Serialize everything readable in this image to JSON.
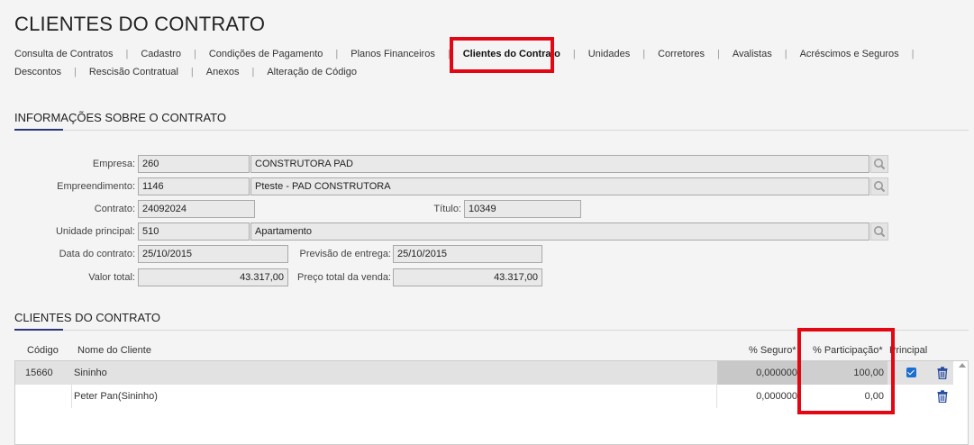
{
  "page_title": "CLIENTES DO CONTRATO",
  "tabs_row1": [
    "Consulta de Contratos",
    "Cadastro",
    "Condições de Pagamento",
    "Planos Financeiros",
    "Clientes do Contrato",
    "Unidades",
    "Corretores",
    "Avalistas",
    "Acréscimos e Seguros"
  ],
  "tabs_row2": [
    "Descontos",
    "Rescisão Contratual",
    "Anexos",
    "Alteração de Código"
  ],
  "active_tab": "Clientes do Contrato",
  "section_info_title": "INFORMAÇÕES SOBRE O CONTRATO",
  "form": {
    "empresa_label": "Empresa:",
    "empresa_code": "260",
    "empresa_name": "CONSTRUTORA PAD",
    "empreendimento_label": "Empreendimento:",
    "empreendimento_code": "1146",
    "empreendimento_name": "Pteste - PAD CONSTRUTORA",
    "contrato_label": "Contrato:",
    "contrato_value": "24092024",
    "titulo_label": "Título:",
    "titulo_value": "10349",
    "unidade_label": "Unidade principal:",
    "unidade_code": "510",
    "unidade_name": "Apartamento",
    "data_contrato_label": "Data do contrato:",
    "data_contrato_value": "25/10/2015",
    "previsao_label": "Previsão de entrega:",
    "previsao_value": "25/10/2015",
    "valor_total_label": "Valor total:",
    "valor_total_value": "43.317,00",
    "preco_total_label": "Preço total da venda:",
    "preco_total_value": "43.317,00"
  },
  "section_clients_title": "CLIENTES DO CONTRATO",
  "grid": {
    "headers": {
      "codigo": "Código",
      "nome": "Nome do Cliente",
      "seguro": "% Seguro*",
      "participacao": "% Participação*",
      "principal": "Principal"
    },
    "rows": [
      {
        "codigo": "15660",
        "nome": "Sininho",
        "seguro": "0,000000",
        "participacao": "100,00",
        "principal": true
      },
      {
        "codigo": "",
        "nome": "Peter Pan(Sininho)",
        "seguro": "0,000000",
        "participacao": "0,00",
        "principal": false
      }
    ]
  },
  "colors": {
    "highlight": "#e30613",
    "accent": "#283779",
    "checkbox": "#1a6fd1",
    "trash": "#2a4fa0"
  },
  "icons": {
    "lookup": "magnifier-icon",
    "delete": "trash-icon"
  }
}
